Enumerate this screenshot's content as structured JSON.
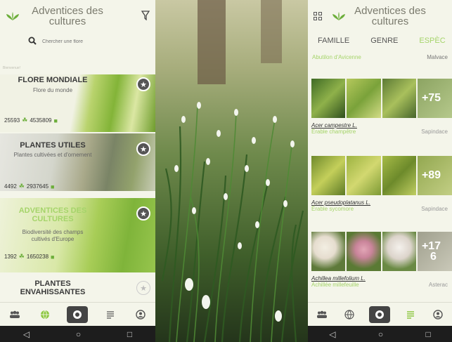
{
  "left": {
    "app_title_line1": "Adventices des",
    "app_title_line2": "cultures",
    "search_placeholder": "Chercher une flore",
    "tiny_label": "Bienvenue!",
    "cards": [
      {
        "title": "FLORE MONDIALE",
        "subtitle": "Flore du monde",
        "count1": "25593",
        "count2": "4535809"
      },
      {
        "title": "PLANTES UTILES",
        "subtitle": "Plantes cultivées et d'ornement",
        "count1": "4492",
        "count2": "2937645"
      },
      {
        "title1": "ADVENTICES DES",
        "title2": "CULTURES",
        "subtitle1": "Biodiversité des champs",
        "subtitle2": "cultivés d'Europe",
        "count1": "1392",
        "count2": "1650238"
      },
      {
        "title1": "PLANTES",
        "title2": "ENVAHISSANTES"
      }
    ]
  },
  "right": {
    "app_title_line1": "Adventices des",
    "app_title_line2": "cultures",
    "tabs": [
      "FAMILLE",
      "GENRE",
      "ESPÈC"
    ],
    "first_row_common": "Abutilon d'Avicenne",
    "first_row_family": "Malvace",
    "species": [
      {
        "latin": "Acer campestre L.",
        "common": "Érable champêtre",
        "family": "Sapindace",
        "more": "+75"
      },
      {
        "latin": "Acer pseudoplatanus L.",
        "common": "Érable sycomore",
        "family": "Sapindace",
        "more": "+89"
      },
      {
        "latin": "Achillea millefolium L.",
        "common": "Achillée millefeuille",
        "family": "Asterac",
        "more_line1": "+17",
        "more_line2": "6"
      }
    ]
  },
  "colors": {
    "accent_green": "#8cc63f",
    "nav_bar": "#1d1d1d",
    "background": "#f4f5ea"
  },
  "icons": [
    "leaf-logo-icon",
    "filter-icon",
    "search-icon",
    "star-icon",
    "community-icon",
    "globe-icon",
    "camera-icon",
    "list-icon",
    "profile-icon",
    "grid-icon",
    "back-icon",
    "home-icon",
    "recent-apps-icon"
  ]
}
